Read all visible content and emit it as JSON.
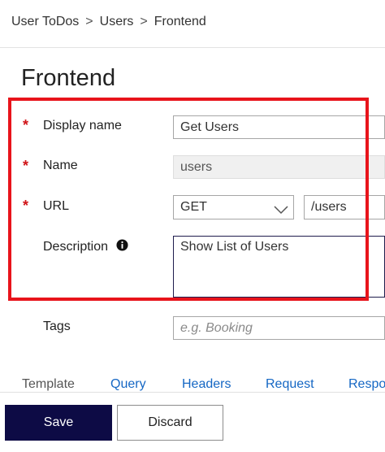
{
  "breadcrumb": {
    "items": [
      "User ToDos",
      "Users",
      "Frontend"
    ],
    "separator": ">"
  },
  "page": {
    "title": "Frontend"
  },
  "form": {
    "required_marker": "*",
    "display_name": {
      "label": "Display name",
      "value": "Get Users"
    },
    "name": {
      "label": "Name",
      "value": "users"
    },
    "url": {
      "label": "URL",
      "method": "GET",
      "path": "/users"
    },
    "description": {
      "label": "Description",
      "value": "Show List of Users",
      "icon": "info-icon"
    },
    "tags": {
      "label": "Tags",
      "placeholder": "e.g. Booking"
    }
  },
  "tabs": [
    "Template",
    "Query",
    "Headers",
    "Request",
    "Response"
  ],
  "actions": {
    "save_label": "Save",
    "discard_label": "Discard"
  },
  "colors": {
    "highlight": "#e8141b",
    "primary_button": "#0d0b45",
    "link": "#1567c4",
    "required": "#d01418"
  }
}
